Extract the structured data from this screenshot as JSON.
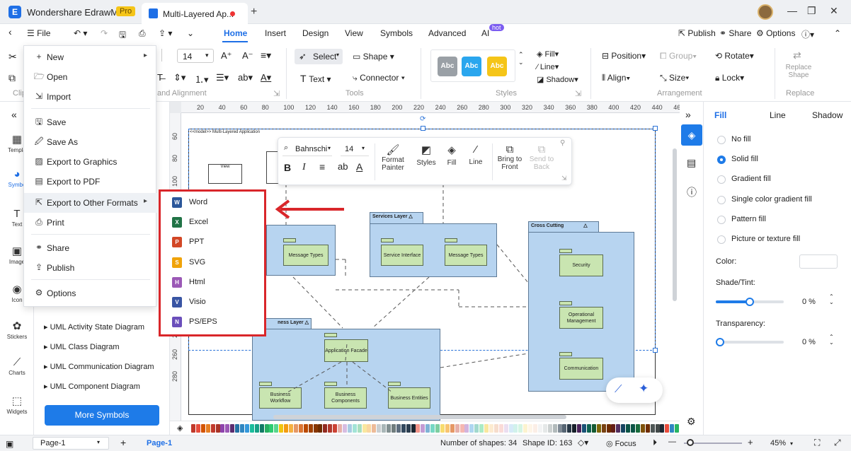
{
  "app": {
    "name": "Wondershare EdrawMax",
    "badge": "Pro",
    "doc_tab": "Multi-Layered Ap...",
    "logo": "E"
  },
  "menubar": {
    "file": "File",
    "tabs": [
      "Home",
      "Insert",
      "Design",
      "View",
      "Symbols",
      "Advanced",
      "AI"
    ],
    "ai_badge": "hot",
    "right": [
      "Publish",
      "Share",
      "Options"
    ]
  },
  "ribbon": {
    "font_size": "14",
    "select": "Select",
    "shape": "Shape",
    "text": "Text",
    "connector": "Connector",
    "style_chip": "Abc",
    "style_colors": [
      "#9aa0a6",
      "#2aa6ee",
      "#f5c518"
    ],
    "fill": "Fill",
    "line": "Line",
    "shadow": "Shadow",
    "position": "Position",
    "group": "Group",
    "rotate": "Rotate",
    "align": "Align",
    "size": "Size",
    "lock": "Lock",
    "replace_shape": "Replace Shape",
    "groups": {
      "alignment": "and Alignment",
      "tools": "Tools",
      "styles": "Styles",
      "arrangement": "Arrangement",
      "replace": "Replace",
      "clip": "Clip"
    }
  },
  "leftnav": {
    "items": [
      "Templa",
      "Symbo",
      "Text",
      "Image",
      "Icon",
      "Stickers",
      "Charts",
      "Widgets"
    ],
    "icons": [
      "templates-icon",
      "symbols-icon",
      "text-icon",
      "image-icon",
      "icon-icon",
      "stickers-icon",
      "charts-icon",
      "widgets-icon"
    ]
  },
  "library": {
    "items": [
      "UML Activity State Diagram",
      "UML Class Diagram",
      "UML Communication Diagram",
      "UML Component Diagram"
    ],
    "more": "More Symbols"
  },
  "file_menu": {
    "items": [
      "New",
      "Open",
      "Import",
      "Save",
      "Save As",
      "Export to Graphics",
      "Export to PDF",
      "Export to Other Formats",
      "Print",
      "Share",
      "Publish",
      "Options"
    ],
    "icons": [
      "new-icon",
      "open-icon",
      "import-icon",
      "save-icon",
      "save-as-icon",
      "export-graphics-icon",
      "export-pdf-icon",
      "export-other-icon",
      "print-icon",
      "share-icon",
      "publish-icon",
      "options-icon"
    ]
  },
  "export_submenu": {
    "items": [
      "Word",
      "Excel",
      "PPT",
      "SVG",
      "Html",
      "Visio",
      "PS/EPS"
    ],
    "letters": [
      "W",
      "X",
      "P",
      "S",
      "H",
      "V",
      "N"
    ],
    "colors": [
      "#2b579a",
      "#217346",
      "#d24726",
      "#f0a30a",
      "#9b59b6",
      "#3955a3",
      "#6b4fbb"
    ]
  },
  "floatbar": {
    "font": "Bahnschi",
    "size": "14",
    "tools": [
      "Format Painter",
      "Styles",
      "Fill",
      "Line",
      "Bring to Front",
      "Send to Back"
    ]
  },
  "ruler": {
    "top": [
      "20",
      "40",
      "60",
      "80",
      "100",
      "120",
      "140",
      "160",
      "180",
      "200",
      "220",
      "240",
      "260",
      "280",
      "300",
      "320",
      "340",
      "360",
      "380",
      "400",
      "420",
      "440",
      "460"
    ],
    "left": [
      "60",
      "80",
      "100",
      "120",
      "140",
      "160",
      "180",
      "200",
      "220",
      "240",
      "260",
      "280"
    ]
  },
  "diagram": {
    "header": "<<model>> Multi-Layered Application",
    "view": "View",
    "packages": [
      "Services Layer",
      "Cross Cutting",
      "ness Layer"
    ],
    "nodes": {
      "message_types_1": "Message Types",
      "service_interface": "Service Interface",
      "message_types_2": "Message Types",
      "security": "Security",
      "operational": "Operational Management",
      "communication": "Communication",
      "app_facade": "Application Facade",
      "workflow": "Business Workflow",
      "components": "Business Components",
      "entities": "Business Entities"
    }
  },
  "rightpanel": {
    "tabs": [
      "Fill",
      "Line",
      "Shadow"
    ],
    "options": [
      "No fill",
      "Solid fill",
      "Gradient fill",
      "Single color gradient fill",
      "Pattern fill",
      "Picture or texture fill"
    ],
    "selected": 1,
    "color_label": "Color:",
    "shade_label": "Shade/Tint:",
    "shade_value": "0 %",
    "transparency_label": "Transparency:",
    "transparency_value": "0 %",
    "shade_level": 0.5,
    "transparency_level": 0,
    "accent": "#1e7be8"
  },
  "palette": {
    "colors": [
      "#c0392b",
      "#e74c3c",
      "#d35400",
      "#e67e22",
      "#c0392b",
      "#a93226",
      "#8e44ad",
      "#9b59b6",
      "#5b2c6f",
      "#2471a3",
      "#2e86c1",
      "#3498db",
      "#1abc9c",
      "#16a085",
      "#117a65",
      "#27ae60",
      "#2ecc71",
      "#58d68d",
      "#f1c40f",
      "#f39c12",
      "#f5b041",
      "#e59866",
      "#dc7633",
      "#ba4a00",
      "#a04000",
      "#873600",
      "#6e2c00",
      "#922b21",
      "#b03a2e",
      "#cb4335",
      "#e6b0aa",
      "#d7bde2",
      "#a9cce3",
      "#a3e4d7",
      "#a9dfbf",
      "#f9e79f",
      "#fad7a0",
      "#edbb99",
      "#cacfd2",
      "#aab7b8",
      "#839192",
      "#717d7e",
      "#5d6d7e",
      "#34495e",
      "#2c3e50",
      "#1b2631",
      "#f1948a",
      "#c39bd3",
      "#7fb3d5",
      "#76d7c4",
      "#7dcea0",
      "#f7dc6f",
      "#f8c471",
      "#e59866",
      "#e6b0aa",
      "#f5b7b1",
      "#d2b4de",
      "#aed6f1",
      "#a2d9ce",
      "#abebc6",
      "#f9e79f",
      "#fdebd0",
      "#f6ddcc",
      "#fadbd8",
      "#ebdef0",
      "#d6eaf8",
      "#d1f2eb",
      "#d5f5e3",
      "#fcf3cf",
      "#fef5e7",
      "#fbeee6",
      "#f2f3f4",
      "#e5e8e8",
      "#ccd1d1",
      "#b2babb",
      "#808b96",
      "#566573",
      "#273746",
      "#17202a",
      "#4a235a",
      "#1a5276",
      "#0e6251",
      "#145a32",
      "#7d6608",
      "#784212",
      "#6e2c00",
      "#641e16",
      "#512e5f",
      "#154360",
      "#0b5345",
      "#0b5345",
      "#186a3b",
      "#7e5109",
      "#6e2c00",
      "#4d5656",
      "#424949",
      "#1c2833",
      "#e74c3c",
      "#2e86c1",
      "#28b463"
    ]
  },
  "status": {
    "page_tab": "Page-1",
    "page_active": "Page-1",
    "shapes": "Number of shapes: 34",
    "shape_id": "Shape ID: 163",
    "focus": "Focus",
    "zoom": "45%"
  }
}
